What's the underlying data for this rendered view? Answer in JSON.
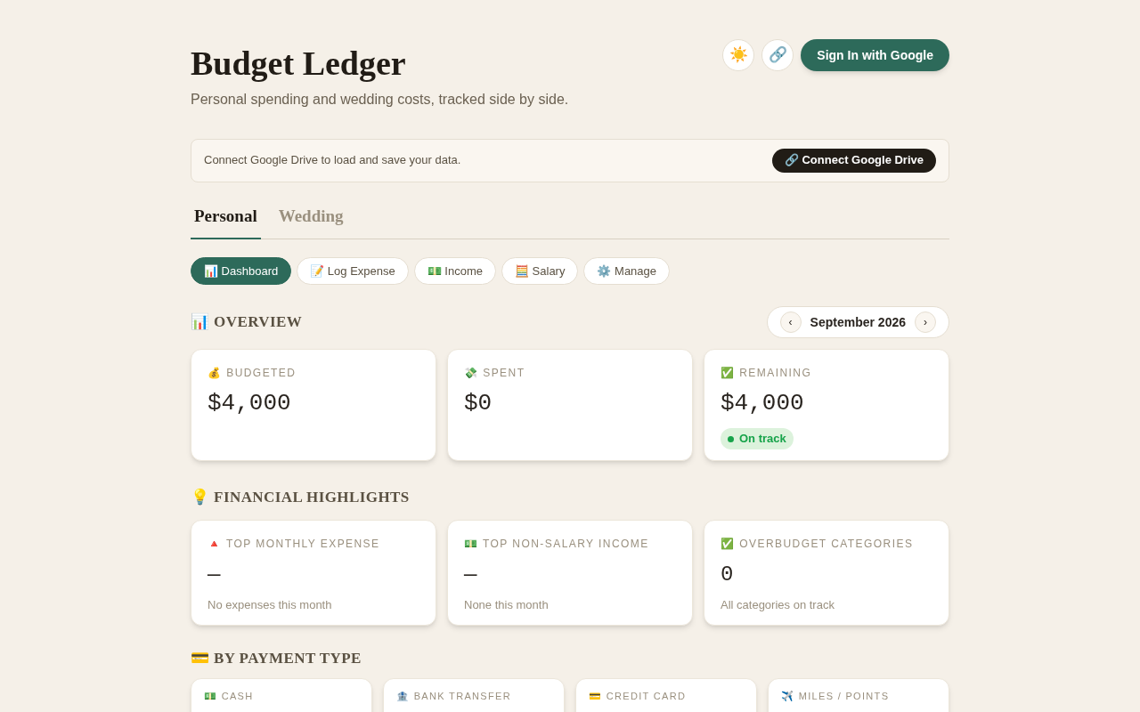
{
  "header": {
    "title": "Budget Ledger",
    "subtitle": "Personal spending and wedding costs, tracked side by side.",
    "theme_button": "☀️",
    "link_button": "🔗",
    "sign_in": "Sign In with Google"
  },
  "drive_banner": {
    "message": "Connect Google Drive to load and save your data.",
    "button": "🔗 Connect Google Drive"
  },
  "tabs": [
    {
      "label": "Personal",
      "selected": true
    },
    {
      "label": "Wedding",
      "selected": false
    }
  ],
  "subtabs": [
    {
      "label": "📊 Dashboard",
      "selected": true
    },
    {
      "label": "📝 Log Expense",
      "selected": false
    },
    {
      "label": "💵 Income",
      "selected": false
    },
    {
      "label": "🧮 Salary",
      "selected": false
    },
    {
      "label": "⚙️ Manage",
      "selected": false
    }
  ],
  "overview": {
    "title": "📊 OVERVIEW",
    "month": {
      "prev": "‹",
      "label": "September 2026",
      "next": "›"
    },
    "cards": [
      {
        "label": "💰 BUDGETED",
        "value": "$4,000"
      },
      {
        "label": "💸 SPENT",
        "value": "$0"
      },
      {
        "label": "✅ REMAINING",
        "value": "$4,000",
        "badge": {
          "text": "On track",
          "color": "#16a34a"
        }
      }
    ]
  },
  "highlights": {
    "title": "💡 FINANCIAL HIGHLIGHTS",
    "cards": [
      {
        "label": "🔺 TOP MONTHLY EXPENSE",
        "value": "—",
        "note": "No expenses this month"
      },
      {
        "label": "💵 TOP NON-SALARY INCOME",
        "value": "—",
        "note": "None this month"
      },
      {
        "label": "✅ OVERBUDGET CATEGORIES",
        "value": "0",
        "note": "All categories on track"
      }
    ]
  },
  "payment_types": {
    "title": "💳 BY PAYMENT TYPE",
    "cards": [
      {
        "label": "💵 CASH"
      },
      {
        "label": "🏦 BANK TRANSFER"
      },
      {
        "label": "💳 CREDIT CARD"
      },
      {
        "label": "✈️ MILES / POINTS"
      }
    ]
  }
}
